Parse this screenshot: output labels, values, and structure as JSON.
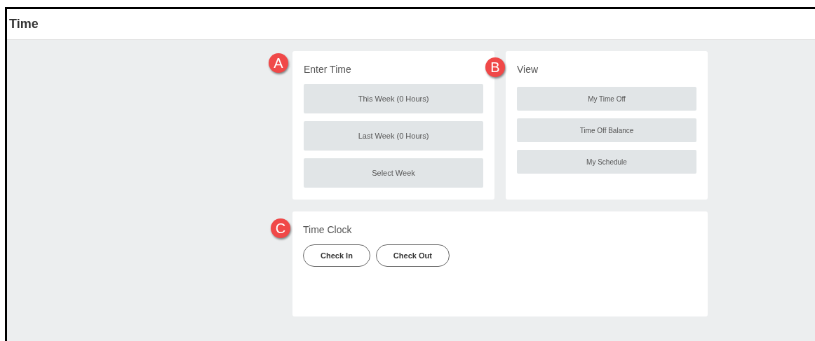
{
  "page": {
    "title": "Time"
  },
  "cards": [
    {
      "kind": "list",
      "badge": "A",
      "title": "Enter Time",
      "buttons": [
        "This Week (0 Hours)",
        "Last Week (0 Hours)",
        "Select Week"
      ]
    },
    {
      "kind": "list",
      "badge": "B",
      "title": "View",
      "buttons": [
        "My Time Off",
        "Time Off Balance",
        "My Schedule"
      ]
    },
    {
      "kind": "clock",
      "badge": "C",
      "title": "Time Clock",
      "buttons": [
        "Check In",
        "Check Out"
      ]
    }
  ]
}
